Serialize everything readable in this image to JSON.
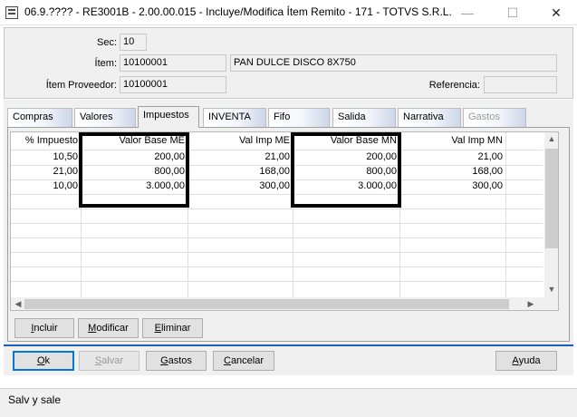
{
  "window": {
    "title": "06.9.???? - RE3001B - 2.00.00.015 - Incluye/Modifica Ítem Remito - 171 - TOTVS S.R.L.",
    "minimize_glyph": "—",
    "maximize_glyph": "☐",
    "close_glyph": "✕"
  },
  "form": {
    "sec_label": "Sec:",
    "sec_value": "10",
    "item_label": "Ítem:",
    "item_code": "10100001",
    "item_desc": "PAN DULCE DISCO 8X750",
    "item_proveedor_label": "Ítem Proveedor:",
    "item_proveedor_value": "10100001",
    "referencia_label": "Referencia:",
    "referencia_value": ""
  },
  "tabs": [
    {
      "label": "Compras",
      "active": false,
      "disabled": false
    },
    {
      "label": "Valores",
      "active": false,
      "disabled": false
    },
    {
      "label": "Impuestos",
      "active": true,
      "disabled": false
    },
    {
      "label": "INVENTA",
      "active": false,
      "disabled": false
    },
    {
      "label": "Fifo",
      "active": false,
      "disabled": false
    },
    {
      "label": "Salida",
      "active": false,
      "disabled": false
    },
    {
      "label": "Narrativa",
      "active": false,
      "disabled": false
    },
    {
      "label": "Gastos",
      "active": false,
      "disabled": true
    }
  ],
  "grid": {
    "columns": [
      "% Impuesto",
      "Valor Base ME",
      "Val Imp ME",
      "Valor Base MN",
      "Val Imp MN"
    ],
    "rows": [
      [
        "10,50",
        "200,00",
        "21,00",
        "200,00",
        "21,00"
      ],
      [
        "21,00",
        "800,00",
        "168,00",
        "800,00",
        "168,00"
      ],
      [
        "10,00",
        "3.000,00",
        "300,00",
        "3.000,00",
        "300,00"
      ]
    ],
    "empty_row_count": 8
  },
  "grid_buttons": {
    "incluir": {
      "u": "I",
      "rest": "ncluir"
    },
    "modificar": {
      "u": "M",
      "rest": "odificar"
    },
    "eliminar": {
      "u": "E",
      "rest": "liminar"
    }
  },
  "bottom_buttons": {
    "ok": {
      "u": "O",
      "rest": "k"
    },
    "salvar": {
      "u": "S",
      "rest": "alvar"
    },
    "gastos": {
      "u": "G",
      "rest": "astos"
    },
    "cancelar": {
      "u": "C",
      "rest": "ancelar"
    },
    "ayuda": {
      "u": "A",
      "rest": "yuda"
    }
  },
  "status": {
    "text": "Salv y sale"
  },
  "colors": {
    "default_button_border": "#0078d7",
    "highlight_box": "#000000",
    "bottom_separator": "#1a5dbf"
  }
}
